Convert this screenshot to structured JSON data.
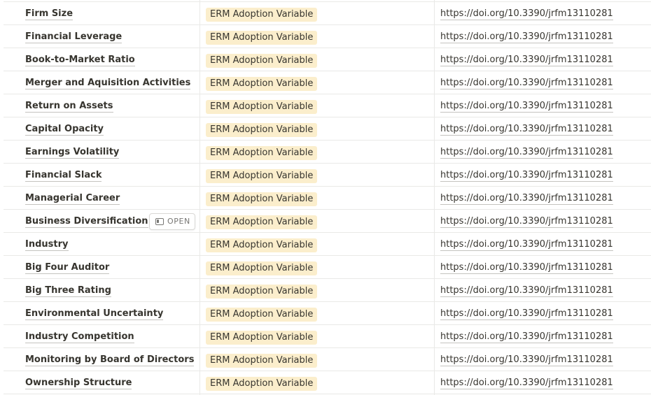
{
  "rows": [
    {
      "name": "Firm Size",
      "tag": "ERM Adoption Variable",
      "url": "https://doi.org/10.3390/jrfm13110281"
    },
    {
      "name": "Financial Leverage",
      "tag": "ERM Adoption Variable",
      "url": "https://doi.org/10.3390/jrfm13110281"
    },
    {
      "name": "Book-to-Market Ratio",
      "tag": "ERM Adoption Variable",
      "url": "https://doi.org/10.3390/jrfm13110281"
    },
    {
      "name": "Merger and Aquisition Activities",
      "tag": "ERM Adoption Variable",
      "url": "https://doi.org/10.3390/jrfm13110281"
    },
    {
      "name": "Return on Assets",
      "tag": "ERM Adoption Variable",
      "url": "https://doi.org/10.3390/jrfm13110281"
    },
    {
      "name": "Capital Opacity",
      "tag": "ERM Adoption Variable",
      "url": "https://doi.org/10.3390/jrfm13110281"
    },
    {
      "name": "Earnings Volatility",
      "tag": "ERM Adoption Variable",
      "url": "https://doi.org/10.3390/jrfm13110281"
    },
    {
      "name": "Financial Slack",
      "tag": "ERM Adoption Variable",
      "url": "https://doi.org/10.3390/jrfm13110281"
    },
    {
      "name": "Managerial Career",
      "tag": "ERM Adoption Variable",
      "url": "https://doi.org/10.3390/jrfm13110281"
    },
    {
      "name": "Business Diversification",
      "tag": "ERM Adoption Variable",
      "url": "https://doi.org/10.3390/jrfm13110281"
    },
    {
      "name": "Industry",
      "tag": "ERM Adoption Variable",
      "url": "https://doi.org/10.3390/jrfm13110281"
    },
    {
      "name": "Big Four Auditor",
      "tag": "ERM Adoption Variable",
      "url": "https://doi.org/10.3390/jrfm13110281"
    },
    {
      "name": "Big Three Rating",
      "tag": "ERM Adoption Variable",
      "url": "https://doi.org/10.3390/jrfm13110281"
    },
    {
      "name": "Environmental Uncertainty",
      "tag": "ERM Adoption Variable",
      "url": "https://doi.org/10.3390/jrfm13110281"
    },
    {
      "name": "Industry Competition",
      "tag": "ERM Adoption Variable",
      "url": "https://doi.org/10.3390/jrfm13110281"
    },
    {
      "name": "Monitoring by Board of Directors",
      "tag": "ERM Adoption Variable",
      "url": "https://doi.org/10.3390/jrfm13110281"
    },
    {
      "name": "Ownership Structure",
      "tag": "ERM Adoption Variable",
      "url": "https://doi.org/10.3390/jrfm13110281"
    }
  ],
  "open_button": {
    "label": "OPEN",
    "icon": "open-page-icon",
    "row_index": 9
  },
  "colors": {
    "tag_background": "#fbeecc",
    "divider": "#e9e9e7",
    "text": "#37352f"
  }
}
